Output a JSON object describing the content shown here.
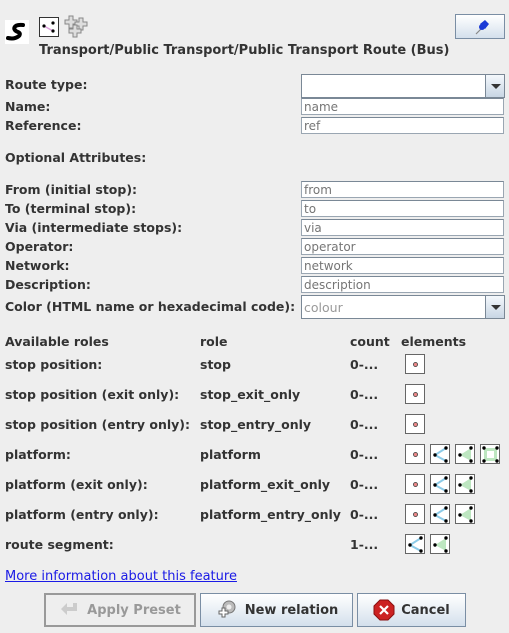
{
  "header": {
    "preset_path": "Transport/Public Transport/Public Transport Route (Bus)",
    "icons": [
      "bus-route-icon",
      "relation-type-icon",
      "multipolygon-crosses-icon"
    ],
    "pin_button_icon": "pushpin-icon"
  },
  "required_fields": [
    {
      "label": "Route type:",
      "type": "combo",
      "value": "",
      "placeholder": ""
    },
    {
      "label": "Name:",
      "type": "text",
      "value": "",
      "placeholder": "name"
    },
    {
      "label": "Reference:",
      "type": "text",
      "value": "",
      "placeholder": "ref"
    }
  ],
  "optional_heading": "Optional Attributes:",
  "optional_fields": [
    {
      "label": "From (initial stop):",
      "type": "text",
      "value": "",
      "placeholder": "from"
    },
    {
      "label": "To (terminal stop):",
      "type": "text",
      "value": "",
      "placeholder": "to"
    },
    {
      "label": "Via (intermediate stops):",
      "type": "text",
      "value": "",
      "placeholder": "via"
    },
    {
      "label": "Operator:",
      "type": "text",
      "value": "",
      "placeholder": "operator"
    },
    {
      "label": "Network:",
      "type": "text",
      "value": "",
      "placeholder": "network"
    },
    {
      "label": "Description:",
      "type": "text",
      "value": "",
      "placeholder": "description"
    },
    {
      "label": "Color (HTML name or hexadecimal code):",
      "type": "combo",
      "value": "",
      "placeholder": "colour"
    }
  ],
  "roles_table": {
    "headers": [
      "Available roles",
      "role",
      "count",
      "elements"
    ],
    "rows": [
      {
        "name": "stop position:",
        "role": "stop",
        "count": "0-...",
        "elements": [
          "node"
        ]
      },
      {
        "name": "stop position (exit only):",
        "role": "stop_exit_only",
        "count": "0-...",
        "elements": [
          "node"
        ]
      },
      {
        "name": "stop position (entry only):",
        "role": "stop_entry_only",
        "count": "0-...",
        "elements": [
          "node"
        ]
      },
      {
        "name": "platform:",
        "role": "platform",
        "count": "0-...",
        "elements": [
          "node",
          "way",
          "closedway",
          "multipolygon"
        ]
      },
      {
        "name": "platform (exit only):",
        "role": "platform_exit_only",
        "count": "0-...",
        "elements": [
          "node",
          "way",
          "closedway"
        ]
      },
      {
        "name": "platform (entry only):",
        "role": "platform_entry_only",
        "count": "0-...",
        "elements": [
          "node",
          "way",
          "closedway"
        ]
      },
      {
        "name": "route segment:",
        "role": "",
        "count": "1-...",
        "elements": [
          "way",
          "closedway"
        ]
      }
    ]
  },
  "more_info_link": "More information about this feature",
  "buttons": {
    "apply": "Apply Preset",
    "new_relation": "New relation",
    "cancel": "Cancel"
  },
  "colors": {
    "link": "#1a1ae6",
    "cancel_icon": "#cc2222",
    "pin": "#1a3ad6"
  }
}
